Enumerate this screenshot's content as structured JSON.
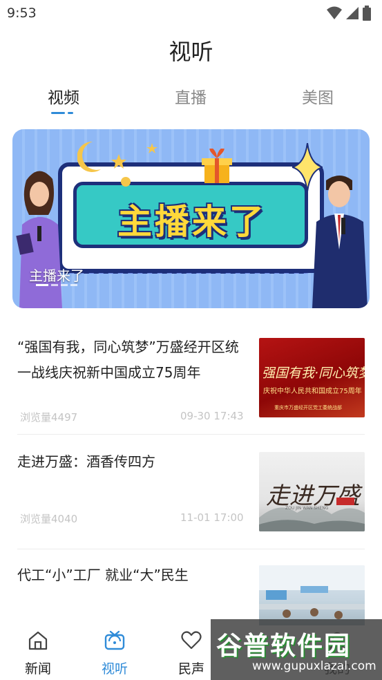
{
  "status_bar": {
    "time": "9:53",
    "icons": [
      "wifi-icon",
      "signal-icon",
      "battery-icon"
    ]
  },
  "header": {
    "title": "视听"
  },
  "tabs": [
    {
      "label": "视频",
      "active": true
    },
    {
      "label": "直播",
      "active": false
    },
    {
      "label": "美图",
      "active": false
    }
  ],
  "banner": {
    "headline": "主播来了",
    "caption": "主播来了",
    "slide_count": 4,
    "active_slide": 1
  },
  "news": [
    {
      "title": "“强国有我，同心筑梦”万盛经开区统一战线庆祝新中国成立75周年",
      "views": "浏览量4497",
      "time": "09-30 17:43",
      "thumb": {
        "line1": "强国有我·同心筑梦",
        "line2": "庆祝中华人民共和国成立75周年",
        "line3": "重庆市万盛经开区党工委统战部"
      }
    },
    {
      "title": "走进万盛：酒香传四方",
      "views": "浏览量4040",
      "time": "11-01 17:00",
      "thumb": {
        "line1": "走进万盛",
        "line2": "ZOU JIN WAN SHENG"
      }
    },
    {
      "title": "代工“小”工厂 就业“大”民生",
      "views": "",
      "time": ""
    }
  ],
  "tabbar": [
    {
      "label": "新闻",
      "icon": "home-icon",
      "active": false
    },
    {
      "label": "视听",
      "icon": "tv-icon",
      "active": true
    },
    {
      "label": "民声",
      "icon": "heart-icon",
      "active": false
    },
    {
      "label": "我的",
      "icon": "user-icon",
      "active": false
    }
  ],
  "watermark": {
    "logo": "谷普软件园",
    "url": "www.gupuxlazal.com"
  },
  "colors": {
    "accent": "#2f8bd8",
    "banner_bg": "#8fb8f5",
    "muted_text": "#c4c4c4"
  }
}
